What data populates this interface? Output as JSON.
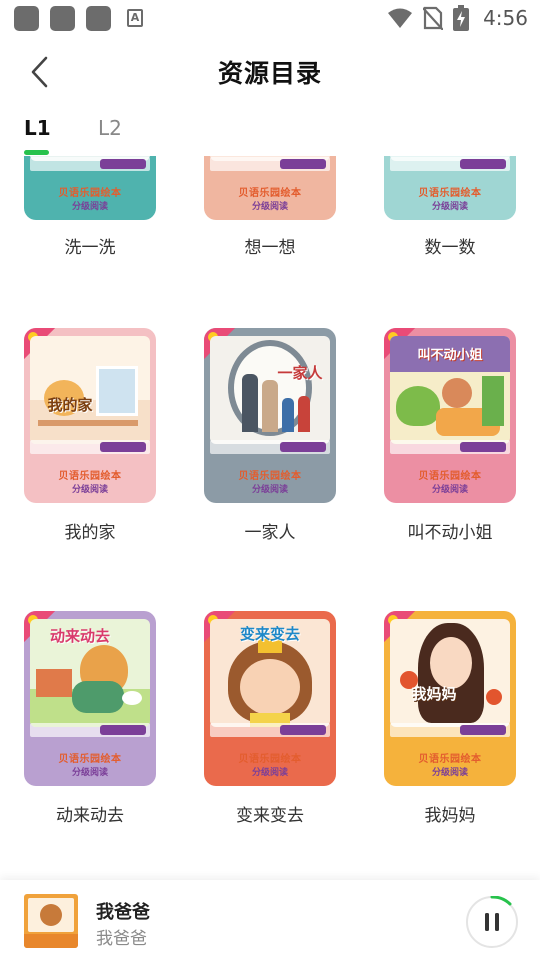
{
  "status_bar": {
    "time": "4:56",
    "left_icons": [
      "notification-icon",
      "notification-icon",
      "notification-icon",
      "a-icon"
    ],
    "right_icons": [
      "wifi-icon",
      "no-sim-icon",
      "battery-charging-icon"
    ]
  },
  "header": {
    "back_icon": "chevron-left-icon",
    "title": "资源目录"
  },
  "tabs": [
    {
      "label": "L1",
      "active": true
    },
    {
      "label": "L2",
      "active": false
    }
  ],
  "books": [
    {
      "label": "洗一洗",
      "cover_color": "#4fb3ae"
    },
    {
      "label": "想一想",
      "cover_color": "#f0b6a0"
    },
    {
      "label": "数一数",
      "cover_color": "#9fd6d3"
    },
    {
      "label": "我的家",
      "cover_color": "#f4c0c3",
      "cover_title": "我的家"
    },
    {
      "label": "一家人",
      "cover_color": "#8c9ba6",
      "cover_title": "一家人"
    },
    {
      "label": "叫不动小姐",
      "cover_color": "#ec8fa3",
      "cover_title": "叫不动小姐"
    },
    {
      "label": "动来动去",
      "cover_color": "#b9a0d0",
      "cover_title": "动来动去"
    },
    {
      "label": "变来变去",
      "cover_color": "#ea6a4c",
      "cover_title": "变来变去"
    },
    {
      "label": "我妈妈",
      "cover_color": "#f5b23c",
      "cover_title": "我妈妈"
    }
  ],
  "cover_brand": {
    "line1": "贝语乐园绘本",
    "line2": "分级阅读"
  },
  "player": {
    "title": "我爸爸",
    "subtitle": "我爸爸",
    "state": "playing",
    "accent": "#27c24c"
  },
  "colors": {
    "accent": "#27c24c"
  }
}
